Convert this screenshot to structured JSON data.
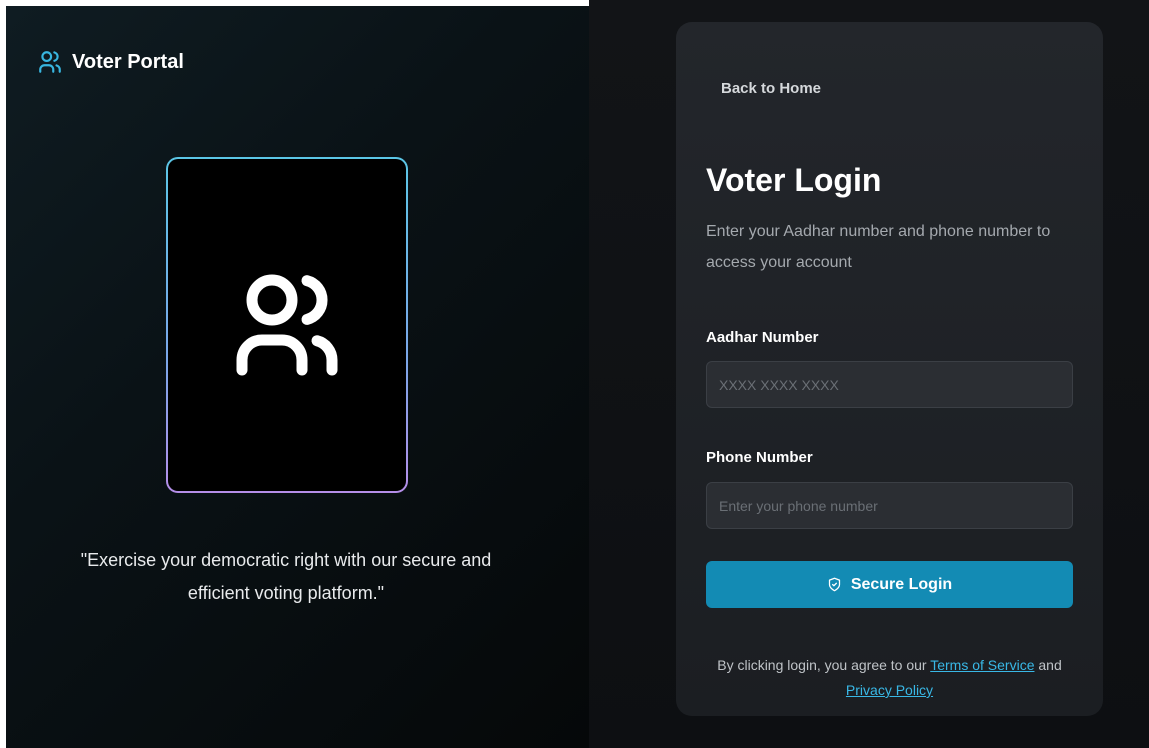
{
  "brand": {
    "name": "Voter Portal",
    "icon": "users-icon"
  },
  "hero": {
    "icon": "users-icon",
    "quote": "\"Exercise your democratic right with our secure and efficient voting platform.\""
  },
  "card": {
    "back_link": "Back to Home",
    "title": "Voter Login",
    "subtitle": "Enter your Aadhar number and phone number to access your account",
    "aadhar": {
      "label": "Aadhar Number",
      "placeholder": "XXXX XXXX XXXX",
      "value": ""
    },
    "phone": {
      "label": "Phone Number",
      "placeholder": "Enter your phone number",
      "value": ""
    },
    "login_button": "Secure Login",
    "login_icon": "shield-check-icon",
    "terms": {
      "prefix": "By clicking login, you agree to our",
      "tos": "Terms of Service",
      "and": "and",
      "privacy": "Privacy Policy"
    }
  },
  "colors": {
    "accent": "#138bb4",
    "link": "#39b8e6",
    "card_bg": "#23262b"
  }
}
